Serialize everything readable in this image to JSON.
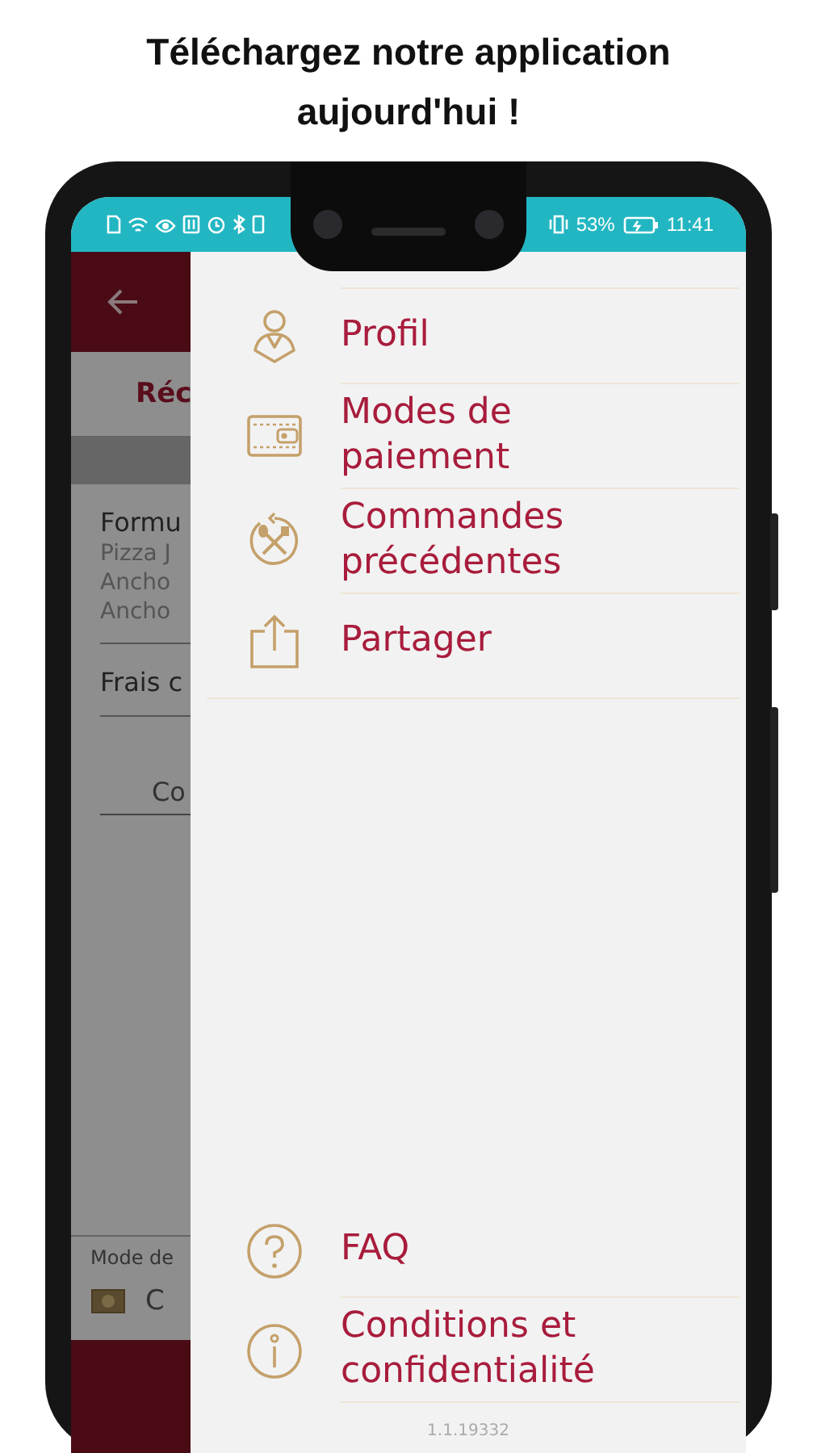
{
  "headline": "Téléchargez notre application aujourd'hui !",
  "status_bar": {
    "battery": "53%",
    "time": "11:41"
  },
  "background_app": {
    "tab_label": "Réc",
    "order_item": {
      "title": "Formu",
      "details": [
        "Pizza J",
        "Ancho",
        "Ancho"
      ]
    },
    "fee_label": "Frais c",
    "button_label": "Co",
    "payment_heading": "Mode de",
    "payment_value": "C"
  },
  "menu": {
    "items": [
      {
        "label": "Profil",
        "kind": "user"
      },
      {
        "label": "Modes de paiement",
        "kind": "wallet"
      },
      {
        "label": "Commandes précédentes",
        "kind": "orders"
      },
      {
        "label": "Partager",
        "kind": "share"
      }
    ],
    "bottom_items": [
      {
        "label": "FAQ",
        "kind": "question"
      },
      {
        "label": "Conditions et confidentialité",
        "kind": "info"
      }
    ],
    "version": "1.1.19332"
  }
}
